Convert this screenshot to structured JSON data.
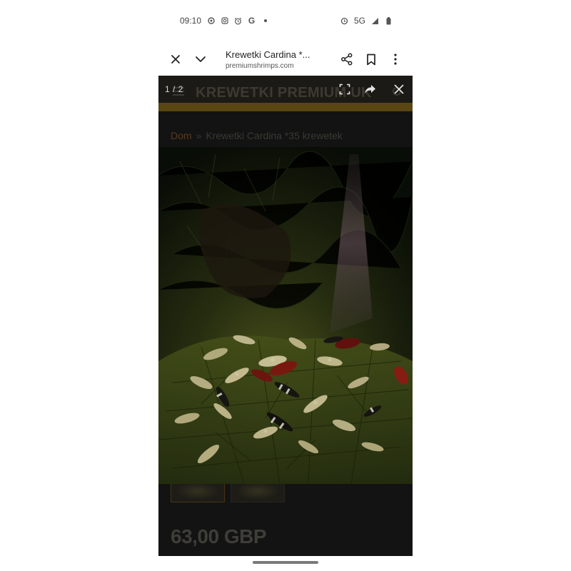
{
  "status_bar": {
    "time": "09:10",
    "network": "5G",
    "left_icons": [
      "settings-dot-icon",
      "instagram-icon",
      "alarm-icon",
      "google-icon",
      "dot-icon"
    ],
    "right_icons": [
      "data-saver-icon",
      "signal-icon",
      "battery-icon"
    ]
  },
  "tab_bar": {
    "title": "Krewetki Cardina *...",
    "url": "premiumshrimps.com"
  },
  "page": {
    "site_name": "KREWETKI PREMIUM UK",
    "breadcrumb": {
      "home": "Dom",
      "separator": "»",
      "current": "Krewetki Cardina *35 krewetek"
    },
    "price": "63,00 GBP"
  },
  "lightbox": {
    "counter": "1 / 2"
  },
  "colors": {
    "page_background": "#131313",
    "gold_accent": "#5a4612",
    "breadcrumb_home": "#5a3a1c"
  }
}
